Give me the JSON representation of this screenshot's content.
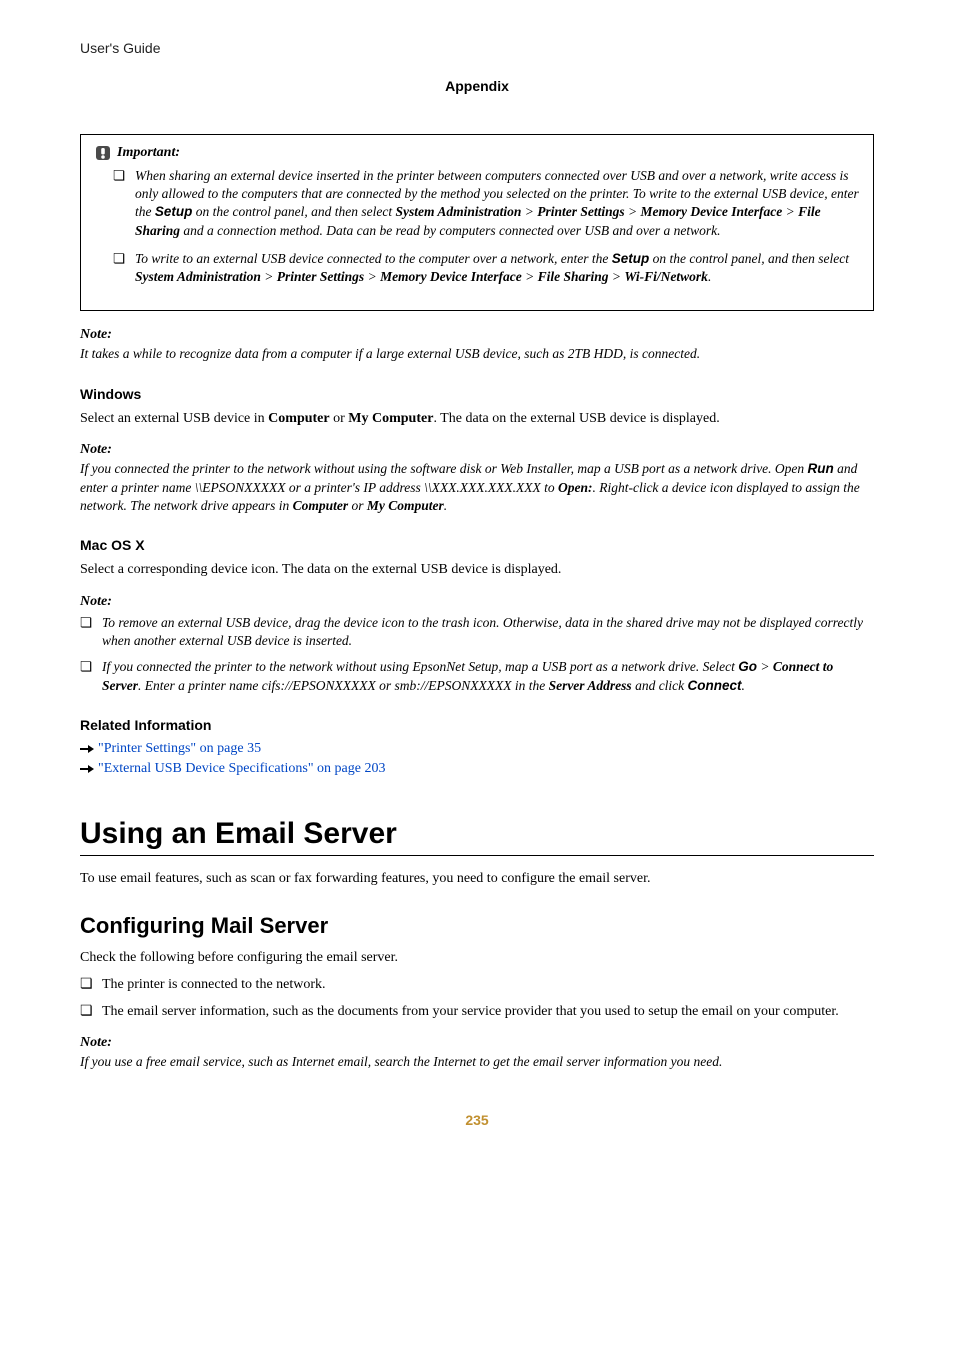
{
  "header": {
    "breadcrumb": "User's Guide",
    "section": "Appendix"
  },
  "important": {
    "label": "Important:",
    "items": [
      {
        "pre": "When sharing an external device inserted in the printer between computers connected over USB and over a network, write access is only allowed to the computers that are connected by the method you selected on the printer. To write to the external USB device, enter the ",
        "b1": "Setup",
        "mid1": " on the control panel, and then select ",
        "b2": "System Administration",
        "g1": " > ",
        "b3": "Printer Settings",
        "g2": " > ",
        "b4": "Memory Device Interface",
        "g3": " > ",
        "b5": "File Sharing",
        "post": " and a connection method. Data can be read by computers connected over USB and over a network."
      },
      {
        "pre": "To write to an external USB device connected to the computer over a network, enter the ",
        "b1": "Setup",
        "mid1": " on the control panel, and then select ",
        "b2": "System Administration",
        "g1": " > ",
        "b3": "Printer Settings",
        "g2": " > ",
        "b4": "Memory Device Interface",
        "g3": " > ",
        "b5": "File Sharing",
        "g4": " > ",
        "b6": "Wi-Fi/Network",
        "post": "."
      }
    ]
  },
  "note1": {
    "label": "Note:",
    "body": "It takes a while to recognize data from a computer if a large external USB device, such as 2TB HDD, is connected."
  },
  "windows": {
    "heading": "Windows",
    "pre": "Select an external USB device in ",
    "b1": "Computer",
    "mid": " or ",
    "b2": "My Computer",
    "post": ". The data on the external USB device is displayed.",
    "noteLabel": "Note:",
    "note_pre": "If you connected the printer to the network without using the software disk or Web Installer, map a USB port as a network drive. Open ",
    "note_b1": "Run",
    "note_mid1": " and enter a printer name \\\\EPSONXXXXX or a printer's IP address \\\\XXX.XXX.XXX.XXX to ",
    "note_b2": "Open:",
    "note_mid2": ". Right-click a device icon displayed to assign the network. The network drive appears in ",
    "note_b3": "Computer",
    "note_mid3": " or ",
    "note_b4": "My Computer",
    "note_post": "."
  },
  "mac": {
    "heading": "Mac OS X",
    "body": "Select a corresponding device icon. The data on the external USB device is displayed.",
    "noteLabel": "Note:",
    "bullets": [
      {
        "text": "To remove an external USB device, drag the device icon to the trash icon. Otherwise, data in the shared drive may not be displayed correctly when another external USB device is inserted."
      },
      {
        "pre": "If you connected the printer to the network without using EpsonNet Setup, map a USB port as a network drive. Select ",
        "b1": "Go",
        "mid1": " > ",
        "b2": "Connect to Server",
        "mid2": ". Enter a printer name cifs://EPSONXXXXX or smb://EPSONXXXXX in the ",
        "b3": "Server Address",
        "mid3": " and click ",
        "b4": "Connect",
        "post": "."
      }
    ]
  },
  "related": {
    "heading": "Related Information",
    "links": [
      "\"Printer Settings\" on page 35",
      "\"External USB Device Specifications\" on page 203"
    ]
  },
  "email": {
    "h1": "Using an Email Server",
    "intro": "To use email features, such as scan or fax forwarding features, you need to configure the email server.",
    "h2": "Configuring Mail Server",
    "check": "Check the following before configuring the email server.",
    "bullets": [
      "The printer is connected to the network.",
      "The email server information, such as the documents from your service provider that you used to setup the email on your computer."
    ],
    "noteLabel": "Note:",
    "noteBody": "If you use a free email service, such as Internet email, search the Internet to get the email server information you need."
  },
  "page_number": "235"
}
